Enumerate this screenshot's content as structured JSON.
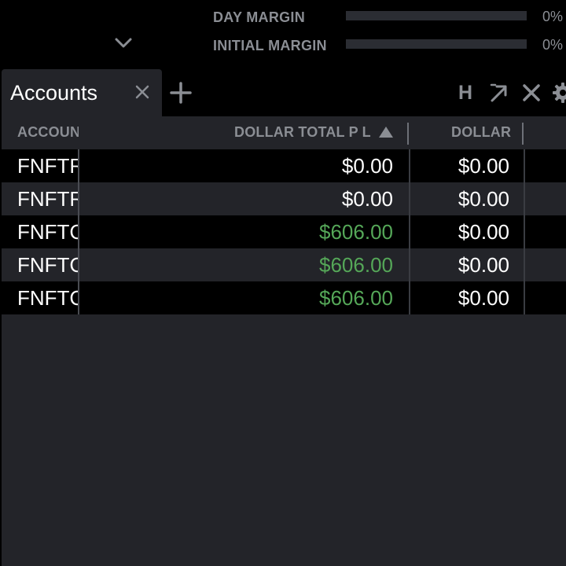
{
  "margins": [
    {
      "label": "DAY MARGIN",
      "percent_text": "0%",
      "fill_fraction": 0
    },
    {
      "label": "INITIAL MARGIN",
      "percent_text": "0%",
      "fill_fraction": 0
    }
  ],
  "tabs": [
    {
      "label": "Accounts",
      "active": true
    }
  ],
  "toolbar": {
    "h_label": "H"
  },
  "grid": {
    "columns": [
      {
        "key": "account",
        "label": "ACCOUNT",
        "visible_text": "ACCOUN"
      },
      {
        "key": "dollar_total_pl",
        "label": "DOLLAR TOTAL P L",
        "sort": "ascending"
      },
      {
        "key": "dollar",
        "label": "DOLLAR"
      }
    ],
    "rows": [
      {
        "account": "FNFTR",
        "dollar_total_pl": "$0.00",
        "dollar": "$0.00",
        "pl_positive": false
      },
      {
        "account": "FNFTR",
        "dollar_total_pl": "$0.00",
        "dollar": "$0.00",
        "pl_positive": false
      },
      {
        "account": "FNFTC",
        "dollar_total_pl": "$606.00",
        "dollar": "$0.00",
        "pl_positive": true
      },
      {
        "account": "FNFTC",
        "dollar_total_pl": "$606.00",
        "dollar": "$0.00",
        "pl_positive": true
      },
      {
        "account": "FNFTC",
        "dollar_total_pl": "$606.00",
        "dollar": "$0.00",
        "pl_positive": true
      }
    ]
  },
  "colors": {
    "background": "#000000",
    "panel": "#232429",
    "muted_text": "#8b8e94",
    "positive": "#55a758",
    "bar_track": "#2b2d33"
  },
  "icons": {
    "collapse": "chevron-down-icon",
    "tab_close": "close-icon",
    "add_tab": "plus-icon",
    "popout": "popout-arrow-icon",
    "close_panel": "close-icon",
    "settings": "gear-icon"
  }
}
